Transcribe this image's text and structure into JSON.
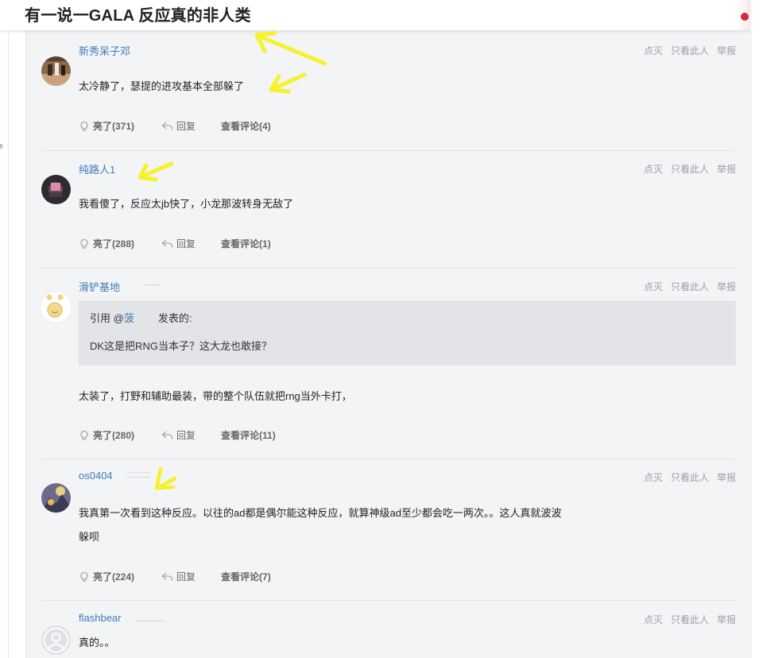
{
  "header": {
    "title": "有一说一GALA 反应真的非人类"
  },
  "labels": {
    "dislike": "点灭",
    "only_this_user": "只看此人",
    "report": "举报",
    "reply": "回复",
    "quote_prefix": "引用 @",
    "quote_posted": "发表的:"
  },
  "comments": [
    {
      "username": "新秀呆子邓",
      "content": "太冷静了，瑟提的进攻基本全部躲了",
      "likes": "亮了(371)",
      "view_replies": "查看评论(4)"
    },
    {
      "username": "纯路人1",
      "content": "我看傻了，反应太jb快了，小龙那波转身无敌了",
      "likes": "亮了(288)",
      "view_replies": "查看评论(1)"
    },
    {
      "username": "滑铲基地",
      "quote_user": "菠",
      "quote_text": "DK这是把RNG当本子？这大龙也敢接？",
      "content": "太装了，打野和辅助最装，带的整个队伍就把rng当外卡打，",
      "likes": "亮了(280)",
      "view_replies": "查看评论(11)"
    },
    {
      "username": "os0404",
      "content_line1": "我真第一次看到这种反应。以往的ad都是偶尔能这种反应，就算神级ad至少都会吃一两次。。这人真就波波",
      "content_line2": "躲呗",
      "likes": "亮了(224)",
      "view_replies": "查看评论(7)"
    },
    {
      "username": "flashbear",
      "content": "真的。。"
    }
  ],
  "colors": {
    "username": "#3e7bb8",
    "panel_bg": "#f3f4f6",
    "quote_bg": "#e3e4e7",
    "arrow": "#f5f22a",
    "meta_text": "#9a9fa8"
  },
  "icons": {
    "like": "lightbulb-icon",
    "reply": "reply-arrow-icon",
    "annotation": "yellow-arrow-annotation"
  }
}
